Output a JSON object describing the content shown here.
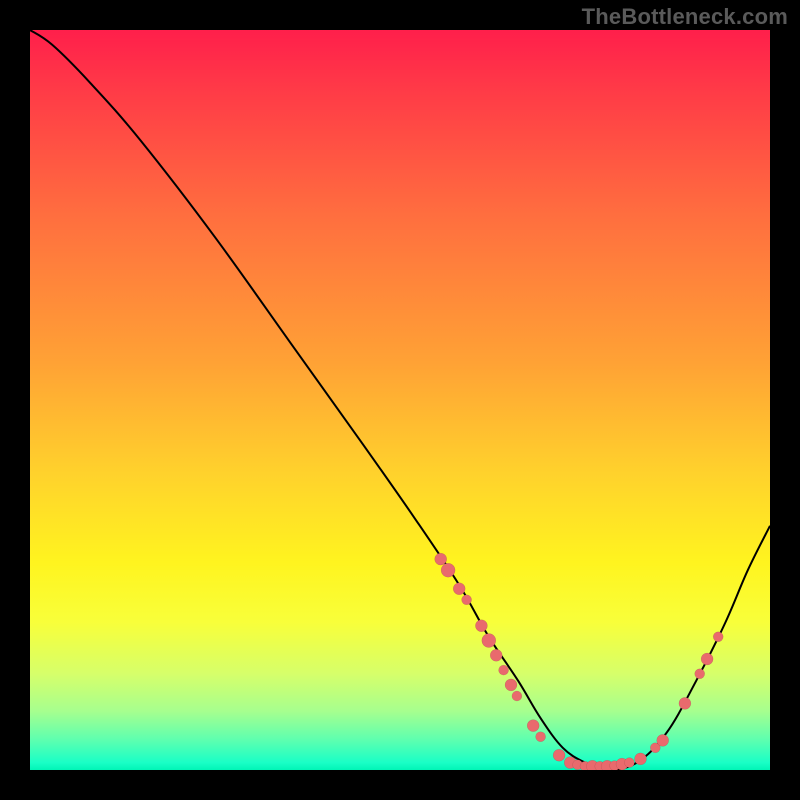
{
  "watermark": "TheBottleneck.com",
  "colors": {
    "background": "#000000",
    "gradient_top": "#ff1f4b",
    "gradient_bottom": "#00f5b6",
    "curve": "#000000",
    "marker": "#e96a6d"
  },
  "chart_data": {
    "type": "line",
    "title": "",
    "xlabel": "",
    "ylabel": "",
    "xlim": [
      0,
      100
    ],
    "ylim": [
      0,
      100
    ],
    "x": [
      0,
      3,
      8,
      15,
      25,
      35,
      45,
      52,
      58,
      62,
      66,
      69,
      72,
      75,
      78,
      82,
      86,
      90,
      94,
      97,
      100
    ],
    "values": [
      100,
      98,
      93,
      85,
      72,
      58,
      44,
      34,
      25,
      18,
      12,
      7,
      3,
      1,
      0,
      1,
      5,
      12,
      20,
      27,
      33
    ],
    "markers": [
      {
        "x": 55.5,
        "y": 28.5,
        "r": 6
      },
      {
        "x": 56.5,
        "y": 27.0,
        "r": 7
      },
      {
        "x": 58.0,
        "y": 24.5,
        "r": 6
      },
      {
        "x": 59.0,
        "y": 23.0,
        "r": 5
      },
      {
        "x": 61.0,
        "y": 19.5,
        "r": 6
      },
      {
        "x": 62.0,
        "y": 17.5,
        "r": 7
      },
      {
        "x": 63.0,
        "y": 15.5,
        "r": 6
      },
      {
        "x": 64.0,
        "y": 13.5,
        "r": 5
      },
      {
        "x": 65.0,
        "y": 11.5,
        "r": 6
      },
      {
        "x": 65.8,
        "y": 10.0,
        "r": 5
      },
      {
        "x": 68.0,
        "y": 6.0,
        "r": 6
      },
      {
        "x": 69.0,
        "y": 4.5,
        "r": 5
      },
      {
        "x": 71.5,
        "y": 2.0,
        "r": 6
      },
      {
        "x": 73.0,
        "y": 1.0,
        "r": 6
      },
      {
        "x": 74.0,
        "y": 0.7,
        "r": 5
      },
      {
        "x": 75.0,
        "y": 0.5,
        "r": 5
      },
      {
        "x": 76.0,
        "y": 0.5,
        "r": 6
      },
      {
        "x": 77.0,
        "y": 0.5,
        "r": 5
      },
      {
        "x": 78.0,
        "y": 0.5,
        "r": 6
      },
      {
        "x": 79.0,
        "y": 0.6,
        "r": 5
      },
      {
        "x": 80.0,
        "y": 0.8,
        "r": 6
      },
      {
        "x": 81.0,
        "y": 1.0,
        "r": 5
      },
      {
        "x": 82.5,
        "y": 1.5,
        "r": 6
      },
      {
        "x": 84.5,
        "y": 3.0,
        "r": 5
      },
      {
        "x": 85.5,
        "y": 4.0,
        "r": 6
      },
      {
        "x": 88.5,
        "y": 9.0,
        "r": 6
      },
      {
        "x": 90.5,
        "y": 13.0,
        "r": 5
      },
      {
        "x": 91.5,
        "y": 15.0,
        "r": 6
      },
      {
        "x": 93.0,
        "y": 18.0,
        "r": 5
      }
    ]
  }
}
